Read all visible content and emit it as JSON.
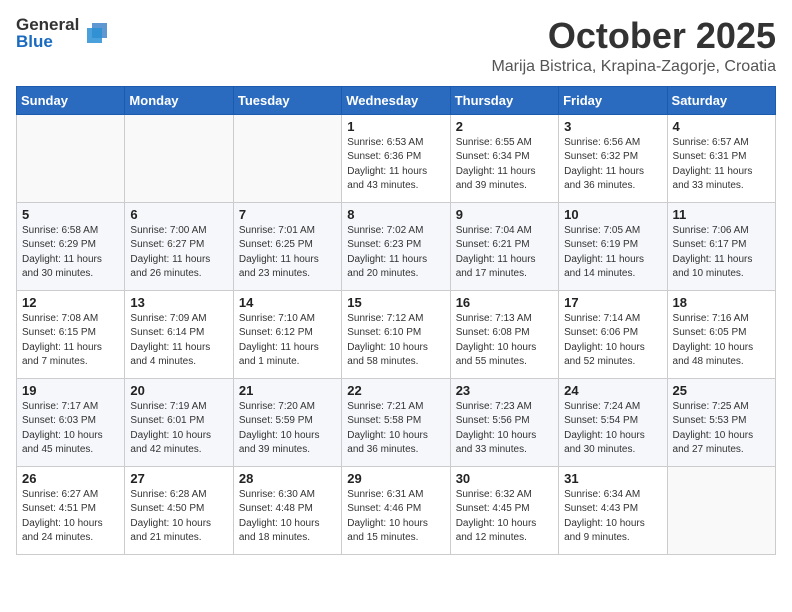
{
  "header": {
    "logo_general": "General",
    "logo_blue": "Blue",
    "month": "October 2025",
    "location": "Marija Bistrica, Krapina-Zagorje, Croatia"
  },
  "weekdays": [
    "Sunday",
    "Monday",
    "Tuesday",
    "Wednesday",
    "Thursday",
    "Friday",
    "Saturday"
  ],
  "weeks": [
    [
      {
        "day": "",
        "info": ""
      },
      {
        "day": "",
        "info": ""
      },
      {
        "day": "",
        "info": ""
      },
      {
        "day": "1",
        "info": "Sunrise: 6:53 AM\nSunset: 6:36 PM\nDaylight: 11 hours and 43 minutes."
      },
      {
        "day": "2",
        "info": "Sunrise: 6:55 AM\nSunset: 6:34 PM\nDaylight: 11 hours and 39 minutes."
      },
      {
        "day": "3",
        "info": "Sunrise: 6:56 AM\nSunset: 6:32 PM\nDaylight: 11 hours and 36 minutes."
      },
      {
        "day": "4",
        "info": "Sunrise: 6:57 AM\nSunset: 6:31 PM\nDaylight: 11 hours and 33 minutes."
      }
    ],
    [
      {
        "day": "5",
        "info": "Sunrise: 6:58 AM\nSunset: 6:29 PM\nDaylight: 11 hours and 30 minutes."
      },
      {
        "day": "6",
        "info": "Sunrise: 7:00 AM\nSunset: 6:27 PM\nDaylight: 11 hours and 26 minutes."
      },
      {
        "day": "7",
        "info": "Sunrise: 7:01 AM\nSunset: 6:25 PM\nDaylight: 11 hours and 23 minutes."
      },
      {
        "day": "8",
        "info": "Sunrise: 7:02 AM\nSunset: 6:23 PM\nDaylight: 11 hours and 20 minutes."
      },
      {
        "day": "9",
        "info": "Sunrise: 7:04 AM\nSunset: 6:21 PM\nDaylight: 11 hours and 17 minutes."
      },
      {
        "day": "10",
        "info": "Sunrise: 7:05 AM\nSunset: 6:19 PM\nDaylight: 11 hours and 14 minutes."
      },
      {
        "day": "11",
        "info": "Sunrise: 7:06 AM\nSunset: 6:17 PM\nDaylight: 11 hours and 10 minutes."
      }
    ],
    [
      {
        "day": "12",
        "info": "Sunrise: 7:08 AM\nSunset: 6:15 PM\nDaylight: 11 hours and 7 minutes."
      },
      {
        "day": "13",
        "info": "Sunrise: 7:09 AM\nSunset: 6:14 PM\nDaylight: 11 hours and 4 minutes."
      },
      {
        "day": "14",
        "info": "Sunrise: 7:10 AM\nSunset: 6:12 PM\nDaylight: 11 hours and 1 minute."
      },
      {
        "day": "15",
        "info": "Sunrise: 7:12 AM\nSunset: 6:10 PM\nDaylight: 10 hours and 58 minutes."
      },
      {
        "day": "16",
        "info": "Sunrise: 7:13 AM\nSunset: 6:08 PM\nDaylight: 10 hours and 55 minutes."
      },
      {
        "day": "17",
        "info": "Sunrise: 7:14 AM\nSunset: 6:06 PM\nDaylight: 10 hours and 52 minutes."
      },
      {
        "day": "18",
        "info": "Sunrise: 7:16 AM\nSunset: 6:05 PM\nDaylight: 10 hours and 48 minutes."
      }
    ],
    [
      {
        "day": "19",
        "info": "Sunrise: 7:17 AM\nSunset: 6:03 PM\nDaylight: 10 hours and 45 minutes."
      },
      {
        "day": "20",
        "info": "Sunrise: 7:19 AM\nSunset: 6:01 PM\nDaylight: 10 hours and 42 minutes."
      },
      {
        "day": "21",
        "info": "Sunrise: 7:20 AM\nSunset: 5:59 PM\nDaylight: 10 hours and 39 minutes."
      },
      {
        "day": "22",
        "info": "Sunrise: 7:21 AM\nSunset: 5:58 PM\nDaylight: 10 hours and 36 minutes."
      },
      {
        "day": "23",
        "info": "Sunrise: 7:23 AM\nSunset: 5:56 PM\nDaylight: 10 hours and 33 minutes."
      },
      {
        "day": "24",
        "info": "Sunrise: 7:24 AM\nSunset: 5:54 PM\nDaylight: 10 hours and 30 minutes."
      },
      {
        "day": "25",
        "info": "Sunrise: 7:25 AM\nSunset: 5:53 PM\nDaylight: 10 hours and 27 minutes."
      }
    ],
    [
      {
        "day": "26",
        "info": "Sunrise: 6:27 AM\nSunset: 4:51 PM\nDaylight: 10 hours and 24 minutes."
      },
      {
        "day": "27",
        "info": "Sunrise: 6:28 AM\nSunset: 4:50 PM\nDaylight: 10 hours and 21 minutes."
      },
      {
        "day": "28",
        "info": "Sunrise: 6:30 AM\nSunset: 4:48 PM\nDaylight: 10 hours and 18 minutes."
      },
      {
        "day": "29",
        "info": "Sunrise: 6:31 AM\nSunset: 4:46 PM\nDaylight: 10 hours and 15 minutes."
      },
      {
        "day": "30",
        "info": "Sunrise: 6:32 AM\nSunset: 4:45 PM\nDaylight: 10 hours and 12 minutes."
      },
      {
        "day": "31",
        "info": "Sunrise: 6:34 AM\nSunset: 4:43 PM\nDaylight: 10 hours and 9 minutes."
      },
      {
        "day": "",
        "info": ""
      }
    ]
  ]
}
